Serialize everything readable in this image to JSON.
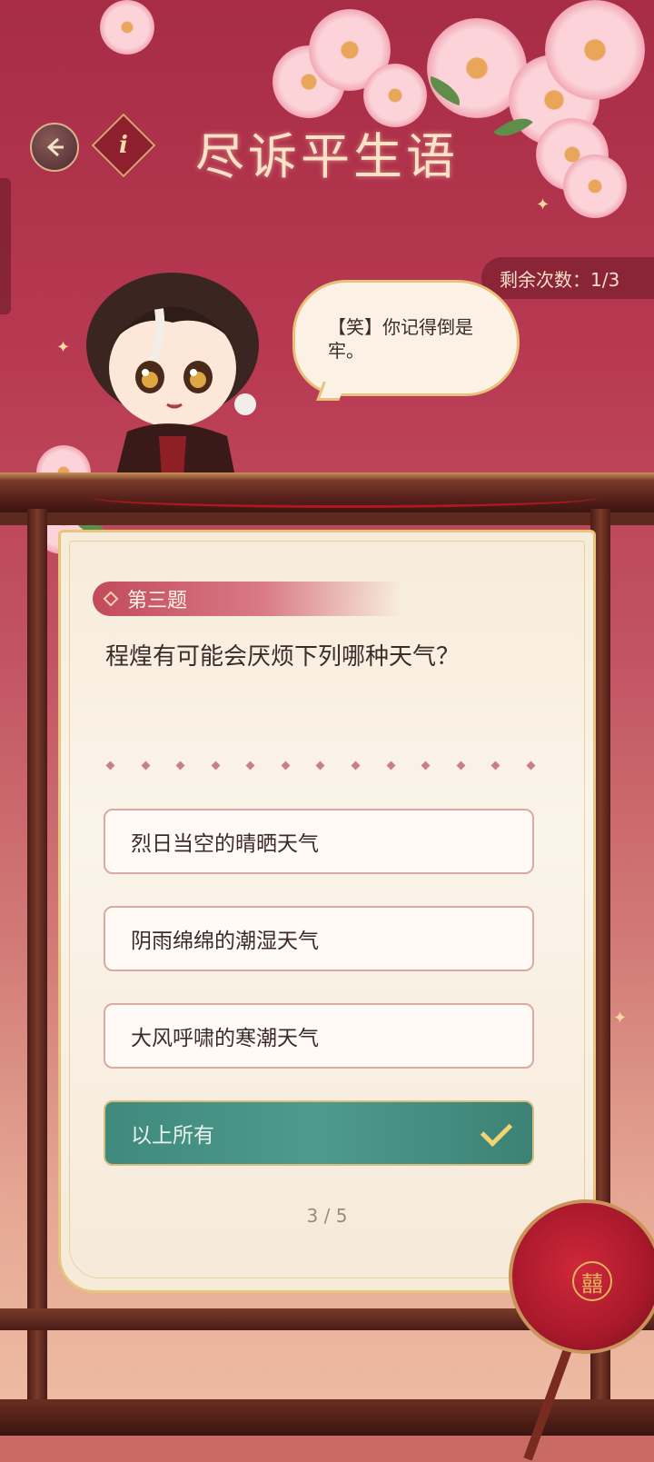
{
  "header": {
    "title": "尽诉平生语",
    "back_icon": "back-arrow-icon",
    "info_icon": "info-icon",
    "info_glyph": "i"
  },
  "attempts": {
    "text": "剩余次数：1/3"
  },
  "speech": {
    "text": "【笑】你记得倒是牢。"
  },
  "quiz": {
    "tag": "第三题",
    "question": "程煌有可能会厌烦下列哪种天气？",
    "options": [
      {
        "label": "烈日当空的晴晒天气",
        "selected": false
      },
      {
        "label": "阴雨绵绵的潮湿天气",
        "selected": false
      },
      {
        "label": "大风呼啸的寒潮天气",
        "selected": false
      },
      {
        "label": "以上所有",
        "selected": true
      }
    ],
    "progress": "3 / 5"
  },
  "colors": {
    "accent_red": "#a72c45",
    "selected_teal": "#4e9a8d",
    "gold": "#e7c57a"
  }
}
